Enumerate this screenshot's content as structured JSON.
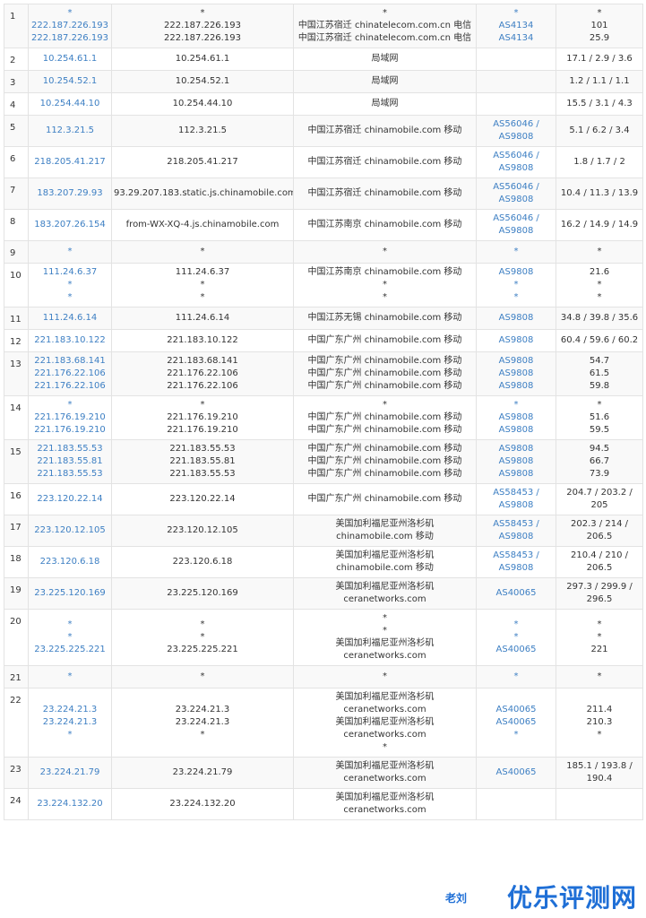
{
  "rows": [
    {
      "hop": "1",
      "ips": [
        "*",
        "222.187.226.193",
        "222.187.226.193"
      ],
      "hosts": [
        "*",
        "222.187.226.193",
        "222.187.226.193"
      ],
      "locs": [
        "*",
        "中国江苏宿迁 chinatelecom.com.cn 电信",
        "中国江苏宿迁 chinatelecom.com.cn 电信"
      ],
      "asns": [
        "*",
        "AS4134",
        "AS4134"
      ],
      "times": [
        "*",
        "101",
        "25.9"
      ]
    },
    {
      "hop": "2",
      "ips": [
        "10.254.61.1"
      ],
      "hosts": [
        "10.254.61.1"
      ],
      "locs": [
        "局域网"
      ],
      "asns": [
        ""
      ],
      "times": [
        "17.1 / 2.9 / 3.6"
      ]
    },
    {
      "hop": "3",
      "ips": [
        "10.254.52.1"
      ],
      "hosts": [
        "10.254.52.1"
      ],
      "locs": [
        "局域网"
      ],
      "asns": [
        ""
      ],
      "times": [
        "1.2 / 1.1 / 1.1"
      ]
    },
    {
      "hop": "4",
      "ips": [
        "10.254.44.10"
      ],
      "hosts": [
        "10.254.44.10"
      ],
      "locs": [
        "局域网"
      ],
      "asns": [
        ""
      ],
      "times": [
        "15.5 / 3.1 / 4.3"
      ]
    },
    {
      "hop": "5",
      "ips": [
        "112.3.21.5"
      ],
      "hosts": [
        "112.3.21.5"
      ],
      "locs": [
        "中国江苏宿迁 chinamobile.com 移动"
      ],
      "asns": [
        "AS56046 /",
        "AS9808"
      ],
      "times": [
        "5.1 / 6.2 / 3.4"
      ]
    },
    {
      "hop": "6",
      "ips": [
        "218.205.41.217"
      ],
      "hosts": [
        "218.205.41.217"
      ],
      "locs": [
        "中国江苏宿迁 chinamobile.com 移动"
      ],
      "asns": [
        "AS56046 /",
        "AS9808"
      ],
      "times": [
        "1.8 / 1.7 / 2"
      ]
    },
    {
      "hop": "7",
      "ips": [
        "183.207.29.93"
      ],
      "hosts": [
        "93.29.207.183.static.js.chinamobile.com"
      ],
      "locs": [
        "中国江苏宿迁 chinamobile.com 移动"
      ],
      "asns": [
        "AS56046 /",
        "AS9808"
      ],
      "times": [
        "10.4 / 11.3 / 13.9"
      ]
    },
    {
      "hop": "8",
      "ips": [
        "183.207.26.154"
      ],
      "hosts": [
        "from-WX-XQ-4.js.chinamobile.com"
      ],
      "locs": [
        "中国江苏南京 chinamobile.com 移动"
      ],
      "asns": [
        "AS56046 /",
        "AS9808"
      ],
      "times": [
        "16.2 / 14.9 / 14.9"
      ]
    },
    {
      "hop": "9",
      "ips": [
        "*"
      ],
      "hosts": [
        "*"
      ],
      "locs": [
        "*"
      ],
      "asns": [
        "*"
      ],
      "times": [
        "*"
      ]
    },
    {
      "hop": "10",
      "ips": [
        "111.24.6.37",
        "*",
        "*"
      ],
      "hosts": [
        "111.24.6.37",
        "*",
        "*"
      ],
      "locs": [
        "中国江苏南京 chinamobile.com 移动",
        "*",
        "*"
      ],
      "asns": [
        "AS9808",
        "*",
        "*"
      ],
      "times": [
        "21.6",
        "*",
        "*"
      ]
    },
    {
      "hop": "11",
      "ips": [
        "111.24.6.14"
      ],
      "hosts": [
        "111.24.6.14"
      ],
      "locs": [
        "中国江苏无锡 chinamobile.com 移动"
      ],
      "asns": [
        "AS9808"
      ],
      "times": [
        "34.8 / 39.8 / 35.6"
      ]
    },
    {
      "hop": "12",
      "ips": [
        "221.183.10.122"
      ],
      "hosts": [
        "221.183.10.122"
      ],
      "locs": [
        "中国广东广州 chinamobile.com 移动"
      ],
      "asns": [
        "AS9808"
      ],
      "times": [
        "60.4 / 59.6 / 60.2"
      ]
    },
    {
      "hop": "13",
      "ips": [
        "221.183.68.141",
        "221.176.22.106",
        "221.176.22.106"
      ],
      "hosts": [
        "221.183.68.141",
        "221.176.22.106",
        "221.176.22.106"
      ],
      "locs": [
        "中国广东广州 chinamobile.com 移动",
        "中国广东广州 chinamobile.com 移动",
        "中国广东广州 chinamobile.com 移动"
      ],
      "asns": [
        "AS9808",
        "AS9808",
        "AS9808"
      ],
      "times": [
        "54.7",
        "61.5",
        "59.8"
      ]
    },
    {
      "hop": "14",
      "ips": [
        "*",
        "221.176.19.210",
        "221.176.19.210"
      ],
      "hosts": [
        "*",
        "221.176.19.210",
        "221.176.19.210"
      ],
      "locs": [
        "*",
        "中国广东广州 chinamobile.com 移动",
        "中国广东广州 chinamobile.com 移动"
      ],
      "asns": [
        "*",
        "AS9808",
        "AS9808"
      ],
      "times": [
        "*",
        "51.6",
        "59.5"
      ]
    },
    {
      "hop": "15",
      "ips": [
        "221.183.55.53",
        "221.183.55.81",
        "221.183.55.53"
      ],
      "hosts": [
        "221.183.55.53",
        "221.183.55.81",
        "221.183.55.53"
      ],
      "locs": [
        "中国广东广州 chinamobile.com 移动",
        "中国广东广州 chinamobile.com 移动",
        "中国广东广州 chinamobile.com 移动"
      ],
      "asns": [
        "AS9808",
        "AS9808",
        "AS9808"
      ],
      "times": [
        "94.5",
        "66.7",
        "73.9"
      ]
    },
    {
      "hop": "16",
      "ips": [
        "223.120.22.14"
      ],
      "hosts": [
        "223.120.22.14"
      ],
      "locs": [
        "中国广东广州 chinamobile.com 移动"
      ],
      "asns": [
        "AS58453 /",
        "AS9808"
      ],
      "times": [
        "204.7 / 203.2 /",
        "205"
      ]
    },
    {
      "hop": "17",
      "ips": [
        "223.120.12.105"
      ],
      "hosts": [
        "223.120.12.105"
      ],
      "locs": [
        "美国加利福尼亚州洛杉矶",
        "chinamobile.com 移动"
      ],
      "asns": [
        "AS58453 /",
        "AS9808"
      ],
      "times": [
        "202.3 / 214 /",
        "206.5"
      ]
    },
    {
      "hop": "18",
      "ips": [
        "223.120.6.18"
      ],
      "hosts": [
        "223.120.6.18"
      ],
      "locs": [
        "美国加利福尼亚州洛杉矶",
        "chinamobile.com 移动"
      ],
      "asns": [
        "AS58453 /",
        "AS9808"
      ],
      "times": [
        "210.4 / 210 /",
        "206.5"
      ]
    },
    {
      "hop": "19",
      "ips": [
        "23.225.120.169"
      ],
      "hosts": [
        "23.225.120.169"
      ],
      "locs": [
        "美国加利福尼亚州洛杉矶",
        "ceranetworks.com"
      ],
      "asns": [
        "AS40065"
      ],
      "times": [
        "297.3 / 299.9 /",
        "296.5"
      ]
    },
    {
      "hop": "20",
      "ips": [
        "*",
        "*",
        "23.225.225.221"
      ],
      "hosts": [
        "*",
        "*",
        "23.225.225.221"
      ],
      "locs": [
        "*",
        "*",
        "美国加利福尼亚州洛杉矶",
        "ceranetworks.com"
      ],
      "asns": [
        "*",
        "*",
        "AS40065"
      ],
      "times": [
        "*",
        "*",
        "221"
      ]
    },
    {
      "hop": "21",
      "ips": [
        "*"
      ],
      "hosts": [
        "*"
      ],
      "locs": [
        "*"
      ],
      "asns": [
        "*"
      ],
      "times": [
        "*"
      ]
    },
    {
      "hop": "22",
      "ips": [
        "23.224.21.3",
        "23.224.21.3",
        "*"
      ],
      "hosts": [
        "23.224.21.3",
        "23.224.21.3",
        "*"
      ],
      "locs": [
        "美国加利福尼亚州洛杉矶",
        "ceranetworks.com",
        "美国加利福尼亚州洛杉矶",
        "ceranetworks.com",
        "*"
      ],
      "asns": [
        "AS40065",
        "AS40065",
        "*"
      ],
      "times": [
        "211.4",
        "210.3",
        "*"
      ]
    },
    {
      "hop": "23",
      "ips": [
        "23.224.21.79"
      ],
      "hosts": [
        "23.224.21.79"
      ],
      "locs": [
        "美国加利福尼亚州洛杉矶",
        "ceranetworks.com"
      ],
      "asns": [
        "AS40065"
      ],
      "times": [
        "185.1 / 193.8 /",
        "190.4"
      ]
    },
    {
      "hop": "24",
      "ips": [
        "23.224.132.20"
      ],
      "hosts": [
        "23.224.132.20"
      ],
      "locs": [
        "美国加利福尼亚州洛杉矶",
        "ceranetworks.com"
      ],
      "asns": [
        ""
      ],
      "times": [
        ""
      ]
    }
  ],
  "watermark": {
    "text": "优乐评测网",
    "small": "老刘"
  }
}
